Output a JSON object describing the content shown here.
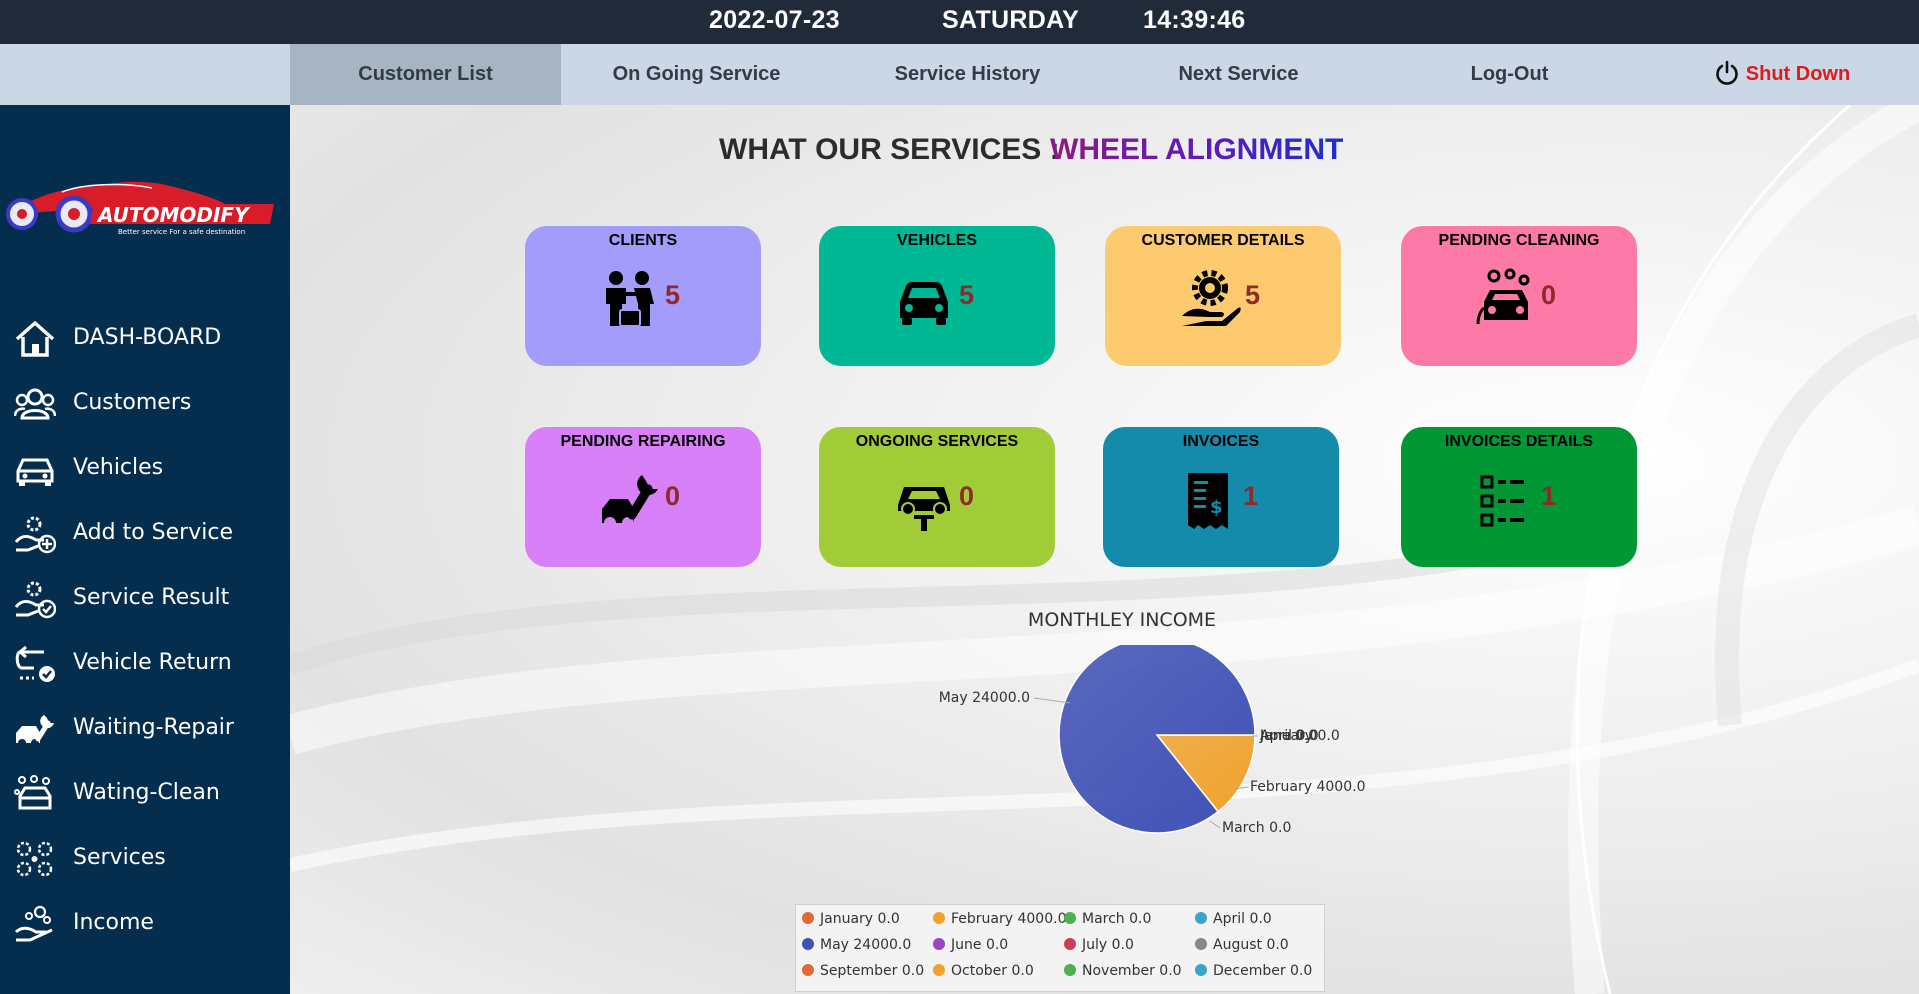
{
  "status_bar": {
    "date": "2022-07-23",
    "day": "SATURDAY",
    "time": "14:39:46"
  },
  "nav": {
    "items": [
      "Customer List",
      "On Going Service",
      "Service History",
      "Next Service",
      "Log-Out"
    ],
    "shutdown_label": "Shut Down",
    "active": "Customer List"
  },
  "sidebar": {
    "logo_text": "AUTOMODIFY",
    "logo_tagline": "Better service For a safe destination",
    "items": [
      {
        "label": "DASH-BOARD",
        "icon": "home-icon"
      },
      {
        "label": "Customers",
        "icon": "customers-icon"
      },
      {
        "label": "Vehicles",
        "icon": "car-icon"
      },
      {
        "label": "Add to Service",
        "icon": "add-service-icon"
      },
      {
        "label": "Service Result",
        "icon": "service-result-icon"
      },
      {
        "label": "Vehicle Return",
        "icon": "vehicle-return-icon"
      },
      {
        "label": "Waiting-Repair",
        "icon": "repair-icon"
      },
      {
        "label": "Wating-Clean",
        "icon": "clean-icon"
      },
      {
        "label": "Services",
        "icon": "services-icon"
      },
      {
        "label": "Income",
        "icon": "income-icon"
      }
    ]
  },
  "services": {
    "label": "WHAT OUR SERVICES :",
    "value": "WHEEL ALIGNMENT"
  },
  "cards": [
    {
      "title": "CLIENTS",
      "count": "5",
      "color": "#a39cfb",
      "icon": "clients-icon"
    },
    {
      "title": "VEHICLES",
      "count": "5",
      "color": "#00b894",
      "icon": "car-icon"
    },
    {
      "title": "CUSTOMER DETAILS",
      "count": "5",
      "color": "#fdca6f",
      "icon": "gear-hand-icon"
    },
    {
      "title": "PENDING CLEANING",
      "count": "0",
      "color": "#fd79a8",
      "icon": "car-wash-icon"
    },
    {
      "title": "PENDING REPAIRING",
      "count": "0",
      "color": "#d880f7",
      "icon": "wrench-car-icon"
    },
    {
      "title": "ONGOING SERVICES",
      "count": "0",
      "color": "#a2cc37",
      "icon": "car-lift-icon"
    },
    {
      "title": "INVOICES",
      "count": "1",
      "color": "#148baa",
      "icon": "receipt-icon"
    },
    {
      "title": "INVOICES DETAILS",
      "count": "1",
      "color": "#009734",
      "icon": "list-icon"
    }
  ],
  "chart_data": {
    "type": "pie",
    "title": "MONTHLEY INCOME",
    "categories": [
      "January",
      "February",
      "March",
      "April",
      "May",
      "June",
      "July",
      "August",
      "September",
      "October",
      "November",
      "December"
    ],
    "values": [
      0.0,
      4000.0,
      0.0,
      0.0,
      24000.0,
      0.0,
      0.0,
      0.0,
      0.0,
      0.0,
      0.0,
      0.0
    ],
    "colors": [
      "#e06a35",
      "#f0a22c",
      "#4caf50",
      "#3aa6c9",
      "#3f51b5",
      "#9c44c4",
      "#cf3b5a",
      "#888888",
      "#e06a35",
      "#f0a22c",
      "#4caf50",
      "#3aa6c9"
    ],
    "slice_labels": [
      "January 0.0",
      "February 4000.0",
      "March 0.0",
      "April 0.0",
      "May 24000.0",
      "June 0.0",
      "July 0.0",
      "August 0.0",
      "September 0.0",
      "October 0.0",
      "November 0.0",
      "December 0.0"
    ],
    "legend_placement": "bottom"
  }
}
